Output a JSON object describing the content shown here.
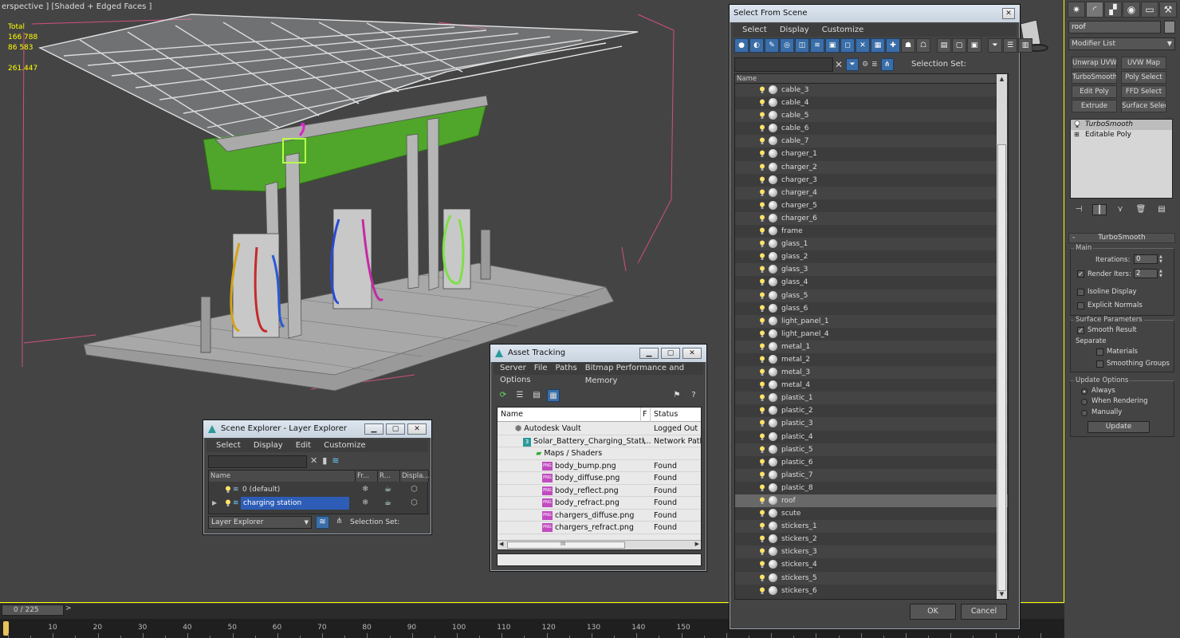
{
  "viewport": {
    "label": "erspective ] [Shaded + Edged Faces ]",
    "stats": {
      "total_label": "Total",
      "v1": "166 788",
      "v2": "86 583",
      "fps": "261.447"
    }
  },
  "timeline": {
    "frame_counter": "0 / 225",
    "next_glyph": ">",
    "ticks": [
      "10",
      "20",
      "30",
      "40",
      "50",
      "60",
      "70",
      "80",
      "90",
      "100",
      "110",
      "120",
      "130",
      "140",
      "150"
    ]
  },
  "command_panel": {
    "name_field": "roof",
    "modifier_list": "Modifier List",
    "buttons": [
      "Unwrap UVW",
      "UVW Map",
      "TurboSmooth",
      "Poly Select",
      "Edit Poly",
      "FFD Select",
      "Extrude",
      "Surface Select"
    ],
    "stack": [
      "TurboSmooth",
      "Editable Poly"
    ],
    "rollout_title": "TurboSmooth",
    "main_group": "Main",
    "iterations_label": "Iterations:",
    "iterations_value": "0",
    "render_iters_label": "Render Iters:",
    "render_iters_value": "2",
    "isoline_label": "Isoline Display",
    "explicit_normals_label": "Explicit Normals",
    "surface_params_group": "Surface Parameters",
    "smooth_result_label": "Smooth Result",
    "separate_label": "Separate",
    "materials_label": "Materials",
    "smoothing_groups_label": "Smoothing Groups",
    "update_options_group": "Update Options",
    "always_label": "Always",
    "when_rendering_label": "When Rendering",
    "manually_label": "Manually",
    "update_button": "Update"
  },
  "select_from_scene": {
    "title": "Select From Scene",
    "menu": [
      "Select",
      "Display",
      "Customize"
    ],
    "selection_set_label": "Selection Set:",
    "column_name": "Name",
    "items": [
      "cable_3",
      "cable_4",
      "cable_5",
      "cable_6",
      "cable_7",
      "charger_1",
      "charger_2",
      "charger_3",
      "charger_4",
      "charger_5",
      "charger_6",
      "frame",
      "glass_1",
      "glass_2",
      "glass_3",
      "glass_4",
      "glass_5",
      "glass_6",
      "light_panel_1",
      "light_panel_4",
      "metal_1",
      "metal_2",
      "metal_3",
      "metal_4",
      "plastic_1",
      "plastic_2",
      "plastic_3",
      "plastic_4",
      "plastic_5",
      "plastic_6",
      "plastic_7",
      "plastic_8",
      "roof",
      "scute",
      "stickers_1",
      "stickers_2",
      "stickers_3",
      "stickers_4",
      "stickers_5",
      "stickers_6"
    ],
    "selected_item": "roof",
    "ok_button": "OK",
    "cancel_button": "Cancel"
  },
  "scene_explorer": {
    "title": "Scene Explorer - Layer Explorer",
    "menu": [
      "Select",
      "Display",
      "Edit",
      "Customize"
    ],
    "columns": [
      "Name",
      "Fr...",
      "R...",
      "Displa..."
    ],
    "layers": [
      "0 (default)",
      "charging station"
    ],
    "bottom_dropdown": "Layer Explorer",
    "selection_set_label": "Selection Set:"
  },
  "asset_tracking": {
    "title": "Asset Tracking",
    "menu": [
      "Server",
      "File",
      "Paths",
      "Bitmap Performance and Memory"
    ],
    "menu2": "Options",
    "columns": [
      "Name",
      "F",
      "Status"
    ],
    "rows": [
      {
        "name": "Autodesk Vault",
        "flag": "",
        "status": "Logged Out ..."
      },
      {
        "name": "Solar_Battery_Charging_Stati...",
        "flag": "\\",
        "status": "Network Path"
      },
      {
        "name": "Maps / Shaders",
        "flag": "",
        "status": ""
      },
      {
        "name": "body_bump.png",
        "flag": "",
        "status": "Found"
      },
      {
        "name": "body_diffuse.png",
        "flag": "",
        "status": "Found"
      },
      {
        "name": "body_reflect.png",
        "flag": "",
        "status": "Found"
      },
      {
        "name": "body_refract.png",
        "flag": "",
        "status": "Found"
      },
      {
        "name": "chargers_diffuse.png",
        "flag": "",
        "status": "Found"
      },
      {
        "name": "chargers_refract.png",
        "flag": "",
        "status": "Found"
      }
    ],
    "png_badge": "PNG",
    "scroll_grip": "III"
  },
  "colors": {
    "viewport_border": "#ffff00",
    "stats_text": "#ffff00",
    "selection_blue": "#2d5db6",
    "toolbar_blue": "#3a6ea8",
    "canopy_green": "#4fa62a"
  }
}
